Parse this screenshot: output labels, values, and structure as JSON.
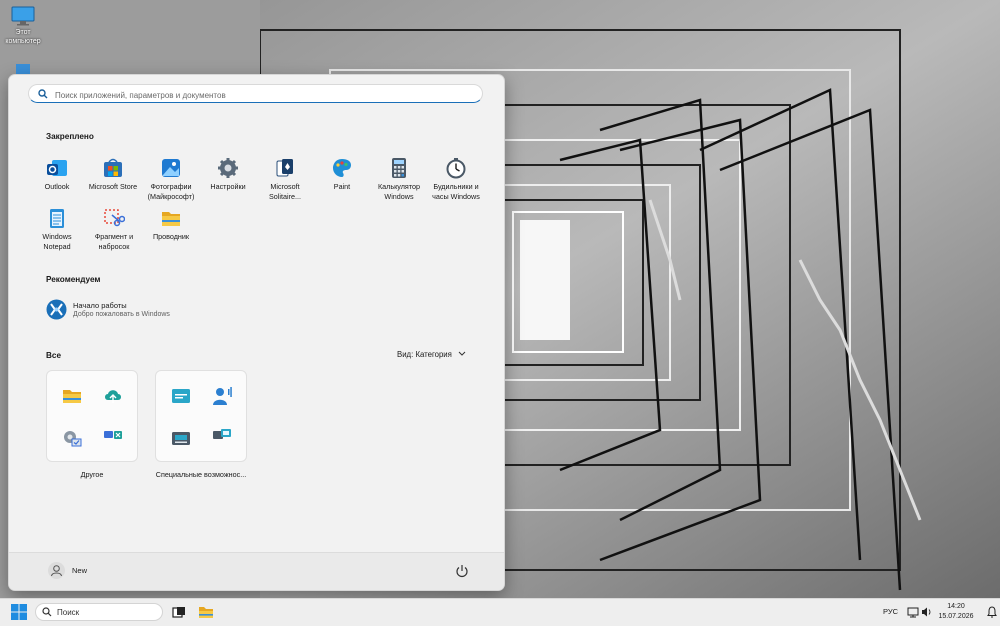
{
  "desktop": {
    "icons": [
      {
        "label": "Этот компьютер",
        "icon": "monitor-icon"
      },
      {
        "label": "",
        "icon": "recycle-bin-icon"
      }
    ]
  },
  "start_menu": {
    "search_placeholder": "Поиск приложений, параметров и документов",
    "pinned_title": "Закреплено",
    "pinned": [
      {
        "label": "Outlook",
        "icon": "outlook-icon"
      },
      {
        "label": "Microsoft Store",
        "icon": "store-icon"
      },
      {
        "label": "Фотографии (Майкрософт)",
        "icon": "photos-icon"
      },
      {
        "label": "Настройки",
        "icon": "settings-gear-icon"
      },
      {
        "label": "Microsoft Solitaire...",
        "icon": "solitaire-icon"
      },
      {
        "label": "Paint",
        "icon": "paint-icon"
      },
      {
        "label": "Калькулятор Windows",
        "icon": "calculator-icon"
      },
      {
        "label": "Будильники и часы Windows",
        "icon": "alarm-clock-icon"
      },
      {
        "label": "Windows Notepad",
        "icon": "notepad-icon"
      },
      {
        "label": "Фрагмент и набросок",
        "icon": "snipping-tool-icon"
      },
      {
        "label": "Проводник",
        "icon": "file-explorer-icon"
      }
    ],
    "recommended_title": "Рекомендуем",
    "recommended": [
      {
        "title": "Начало работы",
        "subtitle": "Добро пожаловать в Windows",
        "icon": "get-started-icon"
      }
    ],
    "all_title": "Все",
    "view_label": "Вид: Категория",
    "categories": [
      {
        "label": "Другое",
        "icons": [
          "folder-icon",
          "cloud-upload-icon",
          "settings-check-icon",
          "remote-connect-icon"
        ]
      },
      {
        "label": "Специальные возможнос...",
        "icons": [
          "on-screen-keyboard-icon",
          "narrator-icon",
          "keyboard-icon",
          "magnifier-icon"
        ]
      }
    ],
    "user_name": "New"
  },
  "taskbar": {
    "search_label": "Поиск",
    "language": "РУС",
    "time": "14:20",
    "date": "15.07.2026"
  },
  "colors": {
    "accent": "#0067c0",
    "folder_yellow": "#f3c33c"
  }
}
